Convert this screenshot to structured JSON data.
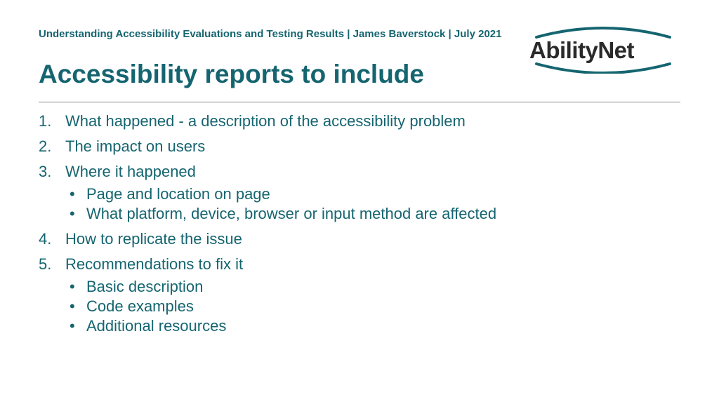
{
  "header": {
    "breadcrumb": "Understanding Accessibility Evaluations and Testing Results | James Baverstock | July 2021",
    "title": "Accessibility reports to include",
    "logo_text": "AbilityNet"
  },
  "items": [
    {
      "text": "What happened - a description of the accessibility problem",
      "sub": []
    },
    {
      "text": "The impact on users",
      "sub": []
    },
    {
      "text": "Where it happened",
      "sub": [
        "Page and location on page",
        "What platform, device, browser or input method are affected"
      ]
    },
    {
      "text": "How to replicate the issue",
      "sub": []
    },
    {
      "text": "Recommendations to fix it",
      "sub": [
        "Basic description",
        "Code examples",
        "Additional resources"
      ]
    }
  ]
}
